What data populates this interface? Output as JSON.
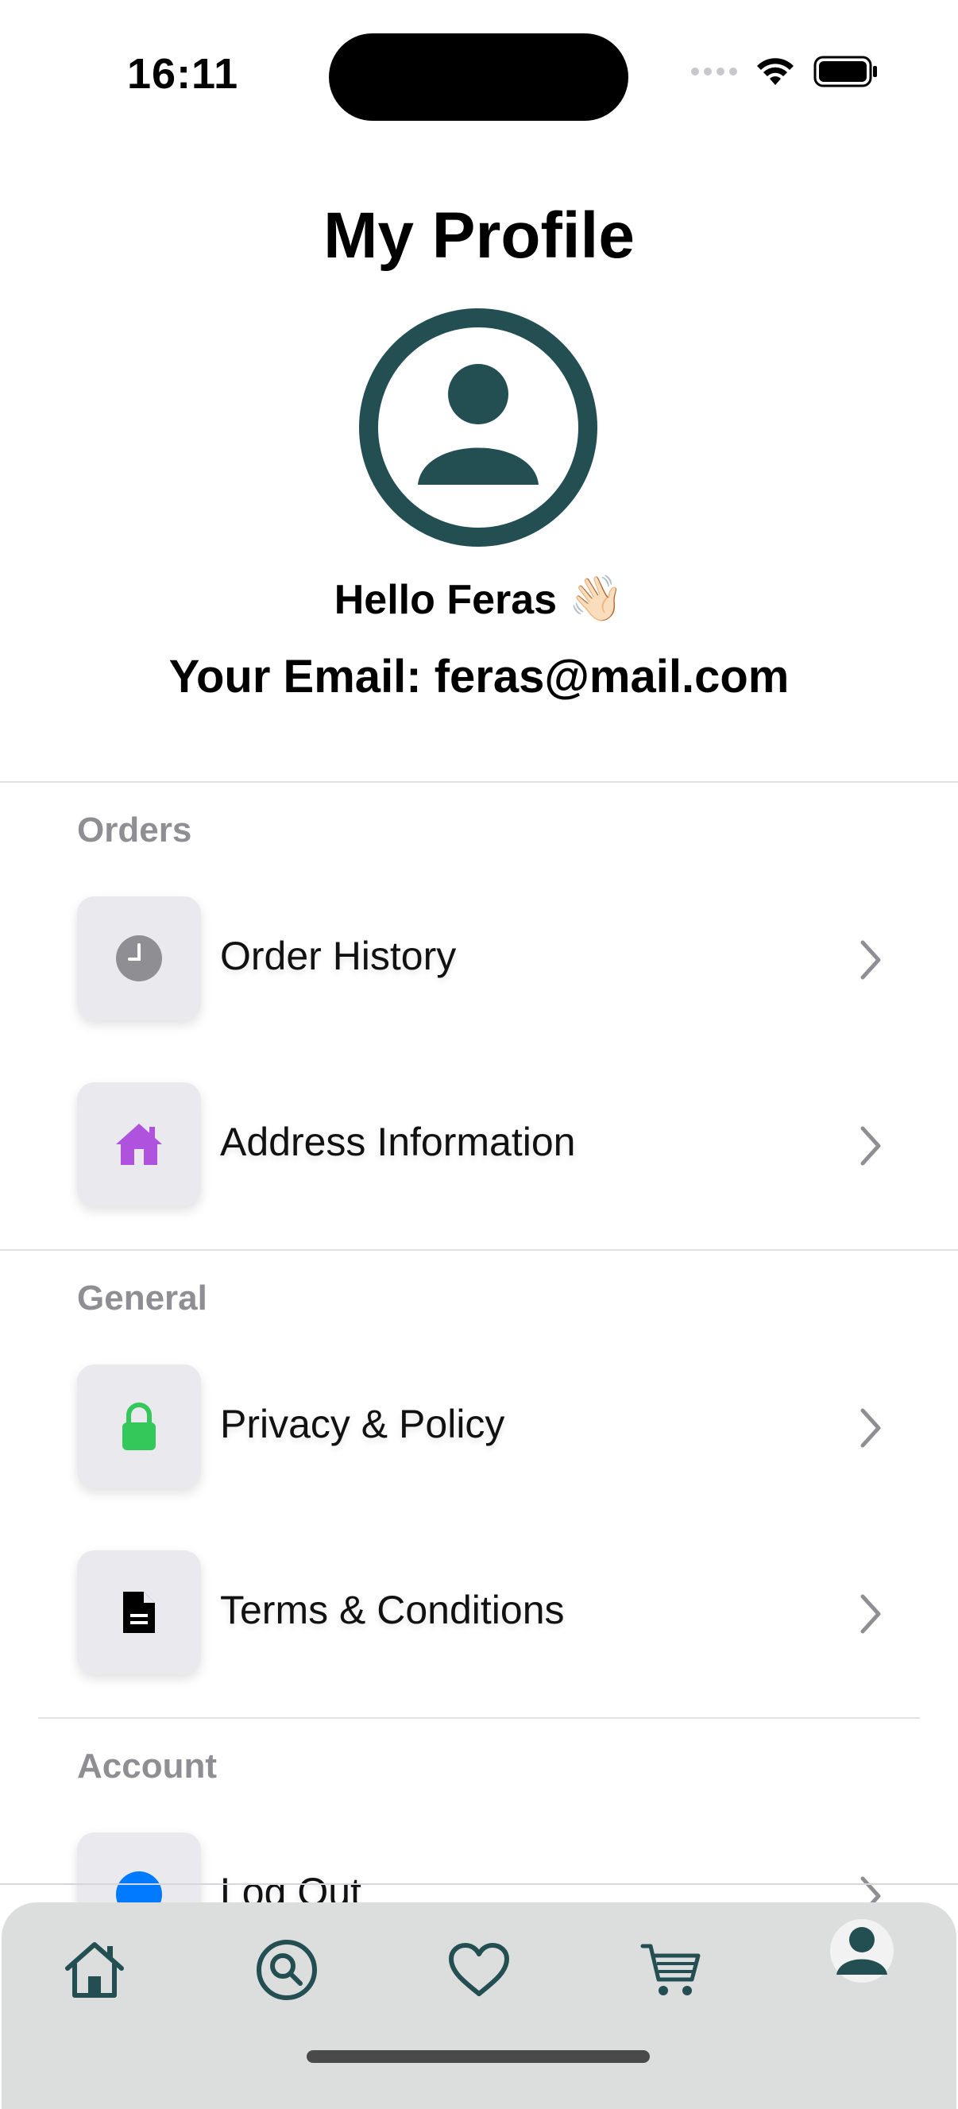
{
  "status_bar": {
    "time": "16:11",
    "icons": [
      "cellular-signal-icon",
      "wifi-icon",
      "battery-icon"
    ]
  },
  "header": {
    "title": "My Profile",
    "avatar_icon": "person-circle-icon",
    "greeting": "Hello Feras",
    "greeting_emoji": "👋🏻",
    "email_line": "Your Email: feras@mail.com"
  },
  "sections": [
    {
      "title": "Orders",
      "items": [
        {
          "label": "Order History",
          "icon": "clock-icon",
          "icon_color": "#8e8e93"
        },
        {
          "label": "Address Information",
          "icon": "house-icon",
          "icon_color": "#af52de"
        }
      ]
    },
    {
      "title": "General",
      "items": [
        {
          "label": "Privacy & Policy",
          "icon": "lock-icon",
          "icon_color": "#34c759"
        },
        {
          "label": "Terms & Conditions",
          "icon": "document-icon",
          "icon_color": "#000000"
        }
      ]
    },
    {
      "title": "Account",
      "items": [
        {
          "label": "Log Out",
          "icon": "logout-icon",
          "icon_color": "#007aff"
        }
      ]
    }
  ],
  "tab_bar": {
    "tabs": [
      "home-icon",
      "search-icon",
      "heart-icon",
      "cart-icon",
      "profile-icon"
    ],
    "selected": "profile-icon"
  },
  "colors": {
    "brand": "#234f52",
    "section_title": "#8e8e93",
    "tile_background": "#e9e9ee",
    "tab_bar_background": "#dcdede"
  }
}
